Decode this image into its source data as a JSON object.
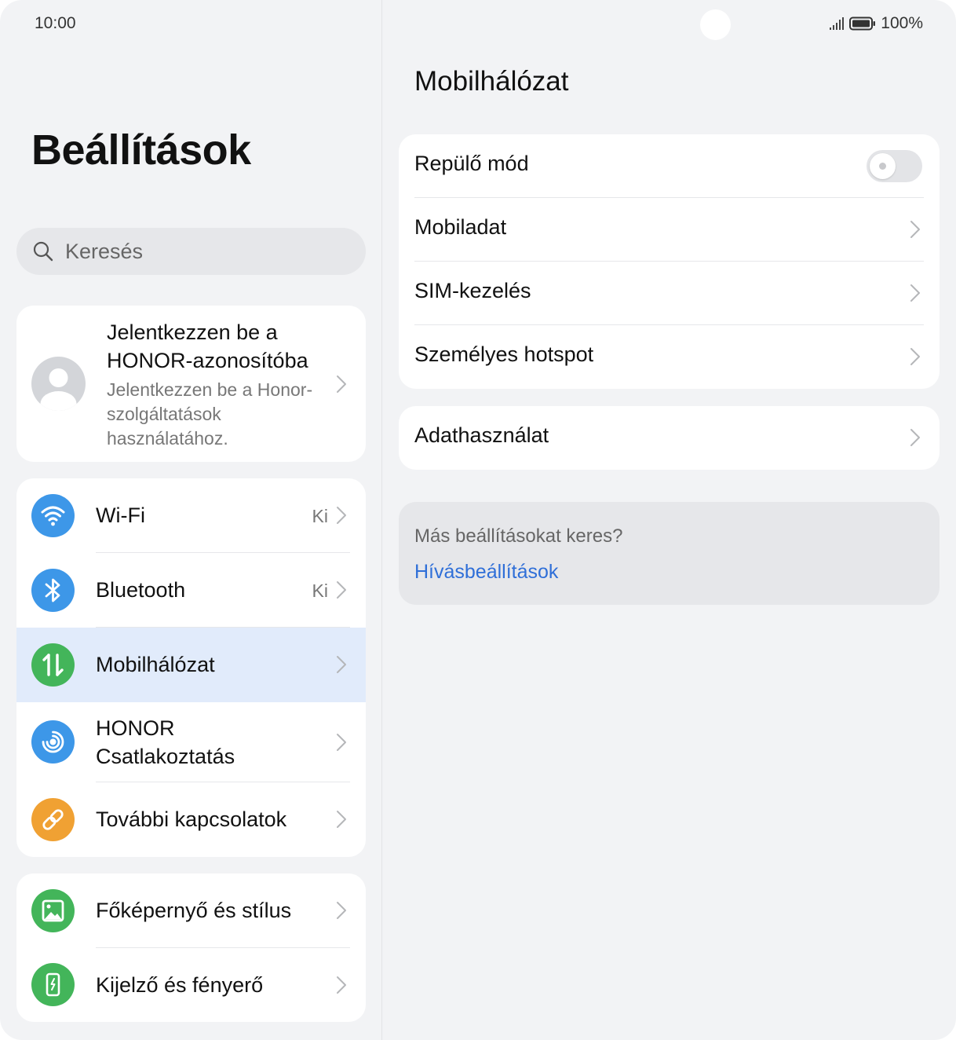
{
  "status_bar": {
    "time": "10:00",
    "battery": "100%"
  },
  "left": {
    "title": "Beállítások",
    "search": {
      "placeholder": "Keresés"
    },
    "account": {
      "title": "Jelentkezzen be a HONOR-azonosítóba",
      "subtitle": "Jelentkezzen be a Honor-szolgáltatások használatához."
    },
    "group1": [
      {
        "label": "Wi-Fi",
        "value": "Ki",
        "icon": "wifi-icon",
        "color": "#3d97e8"
      },
      {
        "label": "Bluetooth",
        "value": "Ki",
        "icon": "bluetooth-icon",
        "color": "#3d97e8"
      },
      {
        "label": "Mobilhálózat",
        "value": "",
        "icon": "mobile-data-icon",
        "color": "#43b55a"
      },
      {
        "label": "HONOR Csatlakoztatás",
        "value": "",
        "icon": "honor-connect-icon",
        "color": "#3d97e8"
      },
      {
        "label": "További kapcsolatok",
        "value": "",
        "icon": "link-icon",
        "color": "#f0a133"
      }
    ],
    "group2": [
      {
        "label": "Főképernyő és stílus",
        "icon": "wallpaper-icon",
        "color": "#43b55a"
      },
      {
        "label": "Kijelző és fényerő",
        "icon": "display-icon",
        "color": "#43b55a"
      }
    ]
  },
  "right": {
    "title": "Mobilhálózat",
    "card1": [
      {
        "label": "Repülő mód",
        "type": "toggle",
        "on": false
      },
      {
        "label": "Mobiladat",
        "type": "link"
      },
      {
        "label": "SIM-kezelés",
        "type": "link"
      },
      {
        "label": "Személyes hotspot",
        "type": "link"
      }
    ],
    "card2": [
      {
        "label": "Adathasználat",
        "type": "link"
      }
    ],
    "hint": {
      "question": "Más beállításokat keres?",
      "link": "Hívásbeállítások"
    }
  },
  "colors": {
    "accent": "#2f6fd8",
    "active_row": "#e1ebfb"
  }
}
